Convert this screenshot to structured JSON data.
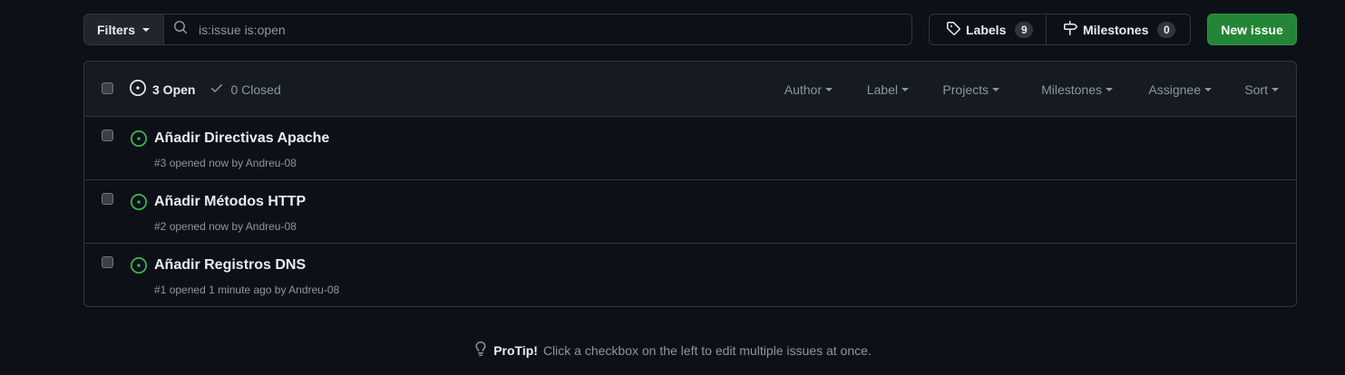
{
  "toolbar": {
    "filters_label": "Filters",
    "search_value": "is:issue is:open",
    "labels_label": "Labels",
    "labels_count": "9",
    "milestones_label": "Milestones",
    "milestones_count": "0",
    "new_issue_label": "New issue"
  },
  "header": {
    "open_label": "3 Open",
    "closed_label": "0 Closed",
    "menus": {
      "author": "Author",
      "label": "Label",
      "projects": "Projects",
      "milestones": "Milestones",
      "assignee": "Assignee",
      "sort": "Sort"
    }
  },
  "issues": [
    {
      "title": "Añadir Directivas Apache",
      "number": "#3",
      "opened": "opened now by",
      "author": "Andreu-08"
    },
    {
      "title": "Añadir Métodos HTTP",
      "number": "#2",
      "opened": "opened now by",
      "author": "Andreu-08"
    },
    {
      "title": "Añadir Registros DNS",
      "number": "#1",
      "opened": "opened 1 minute ago by",
      "author": "Andreu-08"
    }
  ],
  "protip": {
    "label": "ProTip!",
    "text": "Click a checkbox on the left to edit multiple issues at once."
  },
  "colors": {
    "background": "#0d1117",
    "open_icon": "#3fb950",
    "new_issue_button": "#238636"
  },
  "icons": {
    "search": "search-icon",
    "labels": "tag-icon",
    "milestones": "milestone-icon",
    "open_issue": "issue-opened-icon",
    "closed": "check-icon",
    "protip": "light-bulb-icon"
  }
}
